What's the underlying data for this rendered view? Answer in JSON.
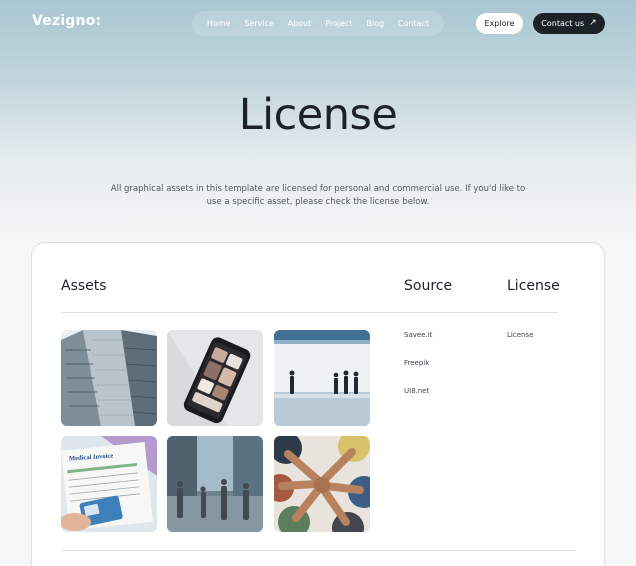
{
  "header": {
    "logo": "Vezigno:",
    "nav": [
      "Home",
      "Service",
      "About",
      "Project",
      "Blog",
      "Contact"
    ],
    "explore_label": "Explore",
    "contact_label": "Contact us",
    "contact_icon": "arrow-up-right-icon"
  },
  "hero": {
    "title": "License",
    "description": "All graphical assets in this template are licensed for personal and commercial use. If you'd like to use a specific asset, please check the license below."
  },
  "table": {
    "headers": {
      "assets": "Assets",
      "source": "Source",
      "license": "License"
    },
    "sources": [
      "Savee.it",
      "Freepik",
      "UI8.net"
    ],
    "licenses": [
      "License"
    ],
    "thumbnails": [
      {
        "name": "skyscraper-photo"
      },
      {
        "name": "phone-app-photo"
      },
      {
        "name": "walking-people-photo"
      },
      {
        "name": "medical-invoice-photo",
        "caption": "Medical Invoice"
      },
      {
        "name": "city-crowd-photo"
      },
      {
        "name": "team-hands-photo"
      }
    ]
  },
  "colors": {
    "dark": "#1b2228",
    "hero_top": "#a9c6d2",
    "background": "#f5f6f6"
  }
}
